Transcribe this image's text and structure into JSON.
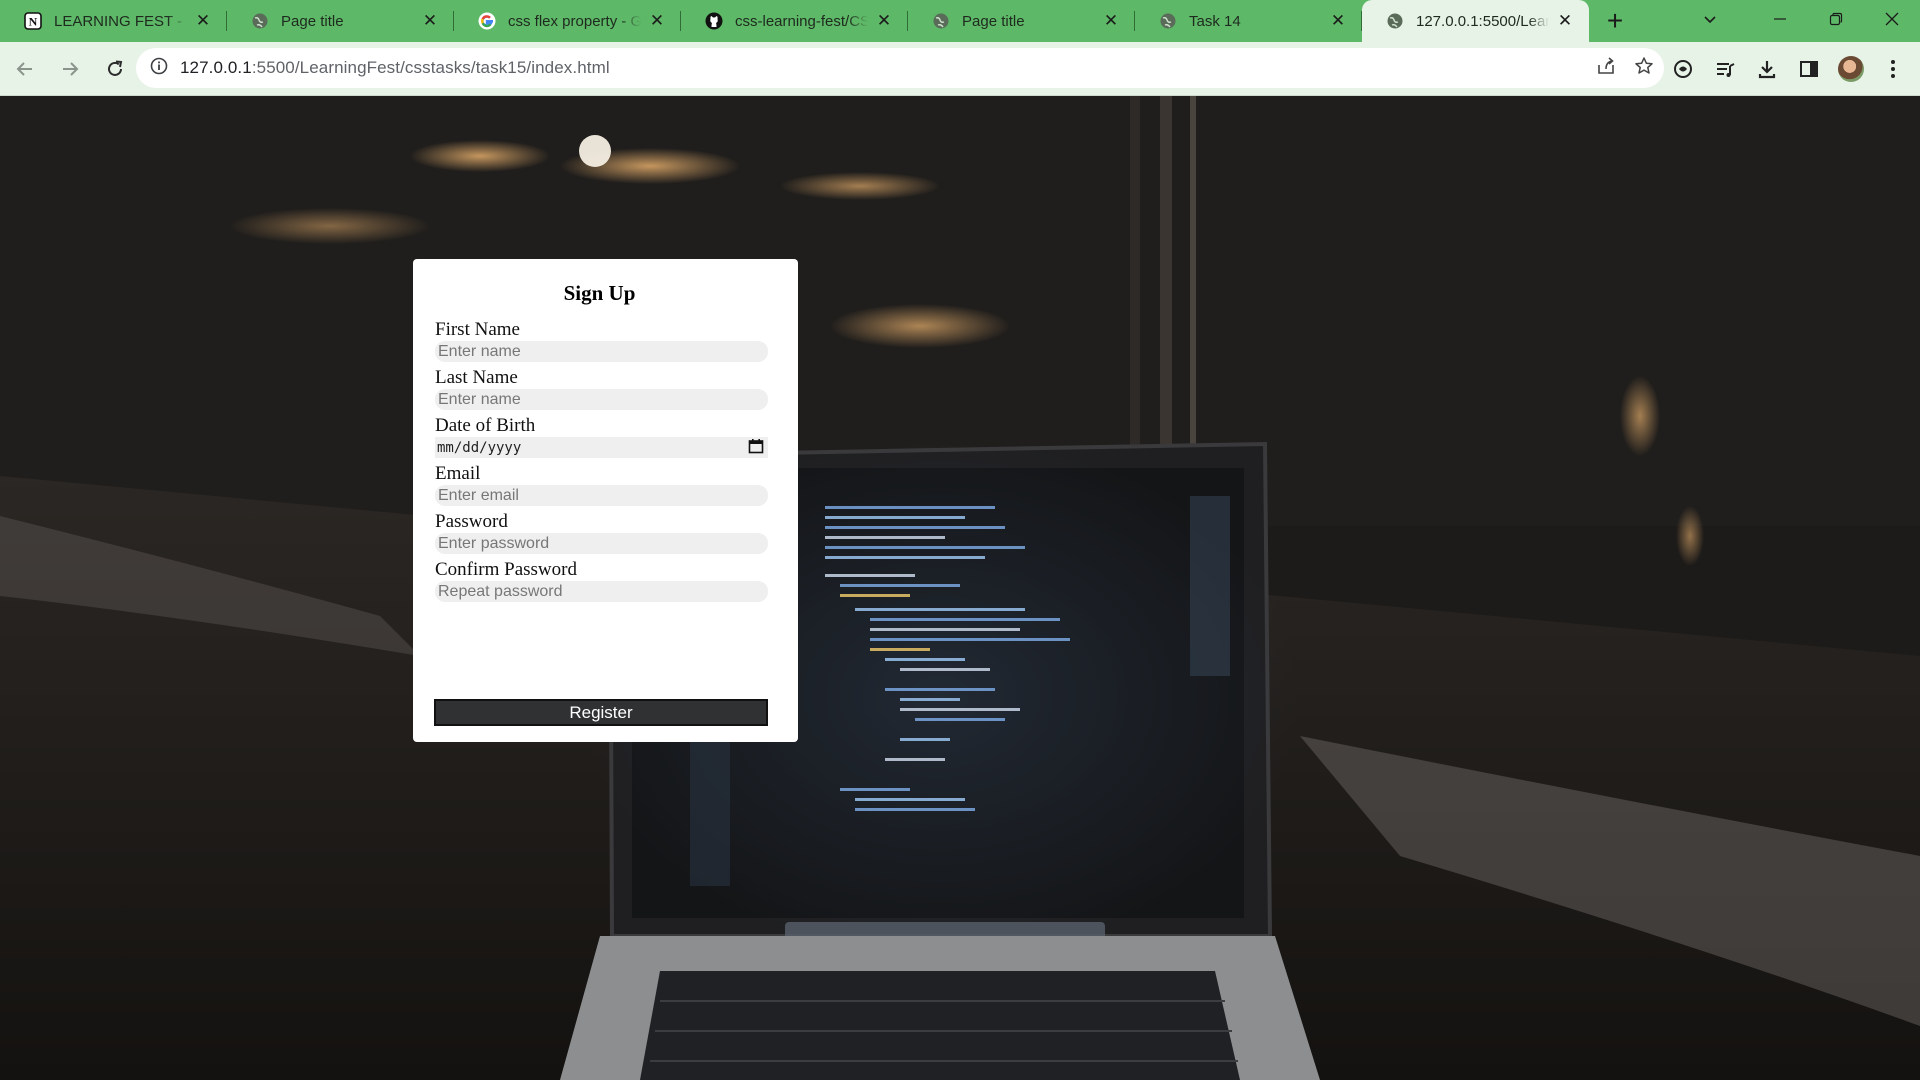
{
  "browser": {
    "tabs": [
      {
        "title": "LEARNING FEST - WE",
        "favicon": "notion-icon"
      },
      {
        "title": "Page title",
        "favicon": "globe-icon"
      },
      {
        "title": "css flex property - Go",
        "favicon": "google-icon"
      },
      {
        "title": "css-learning-fest/CSS",
        "favicon": "github-icon"
      },
      {
        "title": "Page title",
        "favicon": "globe-icon"
      },
      {
        "title": "Task 14",
        "favicon": "globe-icon"
      },
      {
        "title": "127.0.0.1:5500/Learn",
        "favicon": "globe-icon",
        "active": true
      }
    ],
    "url_host": "127.0.0.1",
    "url_path": ":5500/LearningFest/csstasks/task15/index.html",
    "colors": {
      "tabstrip": "#5db867",
      "toolbar": "#e8f3e8"
    }
  },
  "form": {
    "heading": "Sign Up",
    "first_name": {
      "label": "First Name",
      "placeholder": "Enter name"
    },
    "last_name": {
      "label": "Last Name",
      "placeholder": "Enter name"
    },
    "dob": {
      "label": "Date of Birth",
      "placeholder": "mm/dd/yyyy"
    },
    "email": {
      "label": "Email",
      "placeholder": "Enter email"
    },
    "password": {
      "label": "Password",
      "placeholder": "Enter password"
    },
    "confirm_password": {
      "label": "Confirm Password",
      "placeholder": "Repeat password"
    },
    "submit_label": "Register",
    "button_color": "#2f3133"
  }
}
